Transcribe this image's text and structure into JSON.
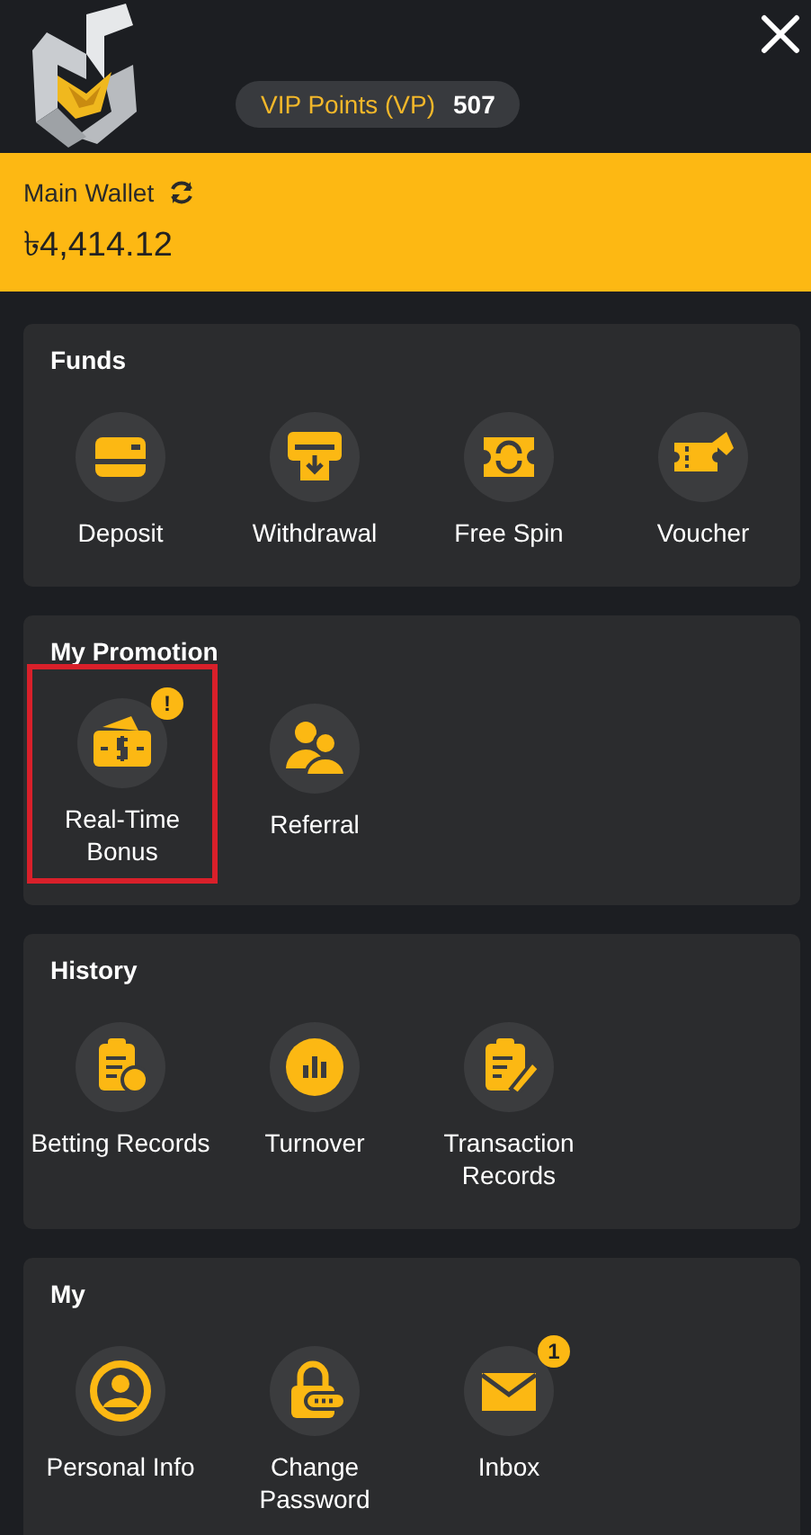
{
  "header": {
    "vip_label": "VIP Points (VP)",
    "vip_points": "507"
  },
  "wallet": {
    "label": "Main Wallet",
    "balance": "৳4,414.12"
  },
  "sections": [
    {
      "title": "Funds",
      "items": [
        {
          "label": "Deposit"
        },
        {
          "label": "Withdrawal"
        },
        {
          "label": "Free Spin"
        },
        {
          "label": "Voucher"
        }
      ]
    },
    {
      "title": "My Promotion",
      "items": [
        {
          "label": "Real-Time Bonus",
          "badge": "!",
          "highlighted": true
        },
        {
          "label": "Referral",
          "highlighted": false
        }
      ]
    },
    {
      "title": "History",
      "items": [
        {
          "label": "Betting Records"
        },
        {
          "label": "Turnover"
        },
        {
          "label": "Transaction Records"
        }
      ]
    },
    {
      "title": "My",
      "items": [
        {
          "label": "Personal Info"
        },
        {
          "label": "Change Password"
        },
        {
          "label": "Inbox",
          "badge": "1"
        }
      ]
    }
  ]
}
